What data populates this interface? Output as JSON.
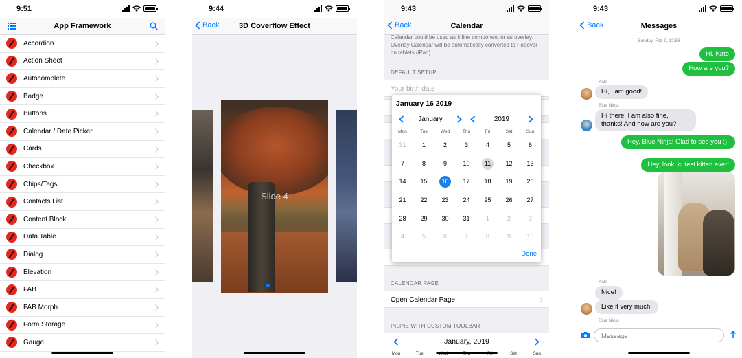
{
  "status_times": [
    "9:51",
    "9:44",
    "9:43",
    "9:43"
  ],
  "accent_color": "#007aff",
  "back_label": "Back",
  "screen1": {
    "title": "App Framework",
    "items": [
      "Accordion",
      "Action Sheet",
      "Autocomplete",
      "Badge",
      "Buttons",
      "Calendar / Date Picker",
      "Cards",
      "Checkbox",
      "Chips/Tags",
      "Contacts List",
      "Content Block",
      "Data Table",
      "Dialog",
      "Elevation",
      "FAB",
      "FAB Morph",
      "Form Storage",
      "Gauge"
    ]
  },
  "screen2": {
    "title": "3D Coverflow Effect",
    "slide_label": "Slide 4"
  },
  "screen3": {
    "title": "Calendar",
    "intro": "Calendar could be used as inline component or as overlay. Overlay Calendar will be automatically converted to Popover on tablets (iPad).",
    "default_setup_header": "DEFAULT SETUP",
    "birth_placeholder": "Your birth date",
    "calendar_page_header": "CALENDAR PAGE",
    "open_calendar_label": "Open Calendar Page",
    "inline_toolbar_header": "INLINE WITH CUSTOM TOOLBAR",
    "inline_month": "January, 2019",
    "inline_dows": [
      "Mon",
      "Tue",
      "Wed",
      "Thu",
      "Fri",
      "Sat",
      "Sun"
    ],
    "popover": {
      "header": "January 16 2019",
      "month": "January",
      "year": "2019",
      "dows": [
        "Mon",
        "Tue",
        "Wed",
        "Thu",
        "Fri",
        "Sat",
        "Sun"
      ],
      "weeks": [
        [
          "31",
          "1",
          "2",
          "3",
          "4",
          "5",
          "6"
        ],
        [
          "7",
          "8",
          "9",
          "10",
          "11",
          "12",
          "13"
        ],
        [
          "14",
          "15",
          "16",
          "17",
          "18",
          "19",
          "20"
        ],
        [
          "21",
          "22",
          "23",
          "24",
          "25",
          "26",
          "27"
        ],
        [
          "28",
          "29",
          "30",
          "31",
          "1",
          "2",
          "3"
        ],
        [
          "4",
          "5",
          "6",
          "7",
          "8",
          "9",
          "10"
        ]
      ],
      "done_label": "Done"
    }
  },
  "screen4": {
    "title": "Messages",
    "date_header": "Sunday, Feb 9, 12:58",
    "messages": [
      {
        "text": "Hi, Kate"
      },
      {
        "text": "How are you?"
      },
      {
        "sender": "Kate",
        "text": "Hi, I am good!"
      },
      {
        "sender": "Blue Ninja",
        "text": "Hi there, I am also fine, thanks! And how are you?"
      },
      {
        "text": "Hey, Blue Ninja! Glad to see you ;)"
      },
      {
        "text": "Hey, look, cutest kitten ever!"
      },
      {
        "sender": "Kate",
        "text": "Nice!"
      },
      {
        "text": "Like it very much!"
      },
      {
        "sender": "Blue Ninja"
      }
    ],
    "input_placeholder": "Message"
  }
}
